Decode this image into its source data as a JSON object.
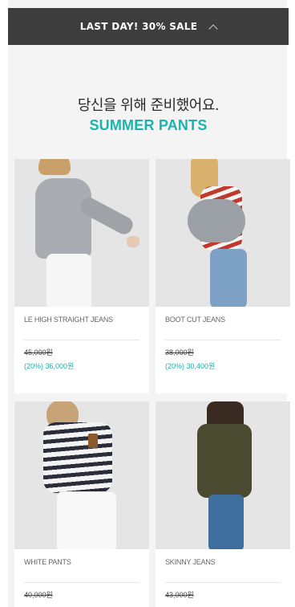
{
  "banner": {
    "text": "LAST DAY! 30% SALE"
  },
  "headline": {
    "ko": "당신을 위해 준비했어요.",
    "en": "SUMMER PANTS"
  },
  "products": [
    {
      "name": "LE HIGH STRAIGHT JEANS",
      "original_price": "45,000원",
      "sale_price": "(20%) 36,000원"
    },
    {
      "name": "BOOT CUT JEANS",
      "original_price": "38,000원",
      "sale_price": "(20%) 30,400원"
    },
    {
      "name": "WHITE PANTS",
      "original_price": "40,000원",
      "sale_price": ""
    },
    {
      "name": "SKINNY JEANS",
      "original_price": "43,000원",
      "sale_price": ""
    }
  ],
  "colors": {
    "accent": "#18b5b0",
    "banner": "#3d3d3d"
  }
}
